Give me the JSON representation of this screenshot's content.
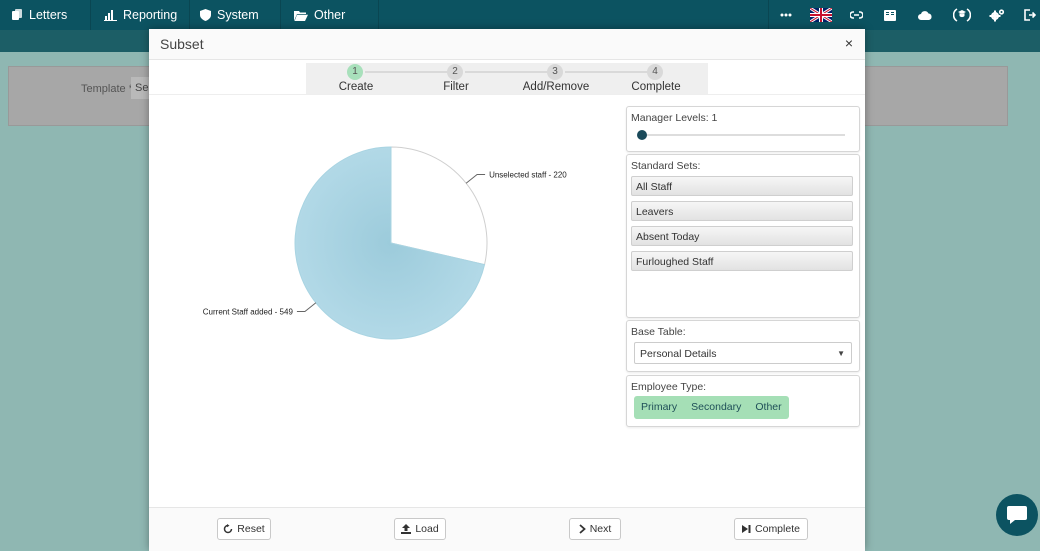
{
  "nav": {
    "items": [
      {
        "label": "Letters",
        "icon": "letters-icon"
      },
      {
        "label": "Reporting",
        "icon": "bar-chart-icon"
      },
      {
        "label": "System",
        "icon": "shield-icon"
      },
      {
        "label": "Other",
        "icon": "folder-open-icon"
      }
    ],
    "right_icons": [
      "more-icon",
      "uk-flag-icon",
      "link-icon",
      "book-icon",
      "cloud-icon",
      "badge-icon",
      "gears-icon",
      "logout-icon"
    ]
  },
  "background": {
    "template_label": "Template *",
    "template_value": "Sel"
  },
  "modal": {
    "title": "Subset",
    "close": "×",
    "steps": [
      {
        "number": "1",
        "label": "Create",
        "active": true
      },
      {
        "number": "2",
        "label": "Filter",
        "active": false
      },
      {
        "number": "3",
        "label": "Add/Remove",
        "active": false
      },
      {
        "number": "4",
        "label": "Complete",
        "active": false
      }
    ]
  },
  "chart_data": {
    "type": "pie",
    "categories": [
      "Unselected staff",
      "Current Staff added"
    ],
    "values": [
      220,
      549
    ],
    "labels": [
      "Unselected staff - 220",
      "Current Staff added - 549"
    ],
    "colors": [
      "#ffffff",
      "#a9d4e2"
    ]
  },
  "panels": {
    "manager_levels": {
      "label": "Manager Levels: 1",
      "value": 1
    },
    "standard_sets": {
      "label": "Standard Sets:",
      "items": [
        "All Staff",
        "Leavers",
        "Absent Today",
        "Furloughed Staff"
      ]
    },
    "base_table": {
      "label": "Base Table:",
      "value": "Personal Details"
    },
    "employee_type": {
      "label": "Employee Type:",
      "options": [
        "Primary",
        "Secondary",
        "Other"
      ]
    }
  },
  "footer": {
    "reset": "Reset",
    "load": "Load",
    "next": "Next",
    "complete": "Complete"
  },
  "colors": {
    "topbar": "#0c5361",
    "pie_fill": "#a9d4e2",
    "step_active": "#a8e0bb",
    "employee_type": "#a5dfb6"
  }
}
